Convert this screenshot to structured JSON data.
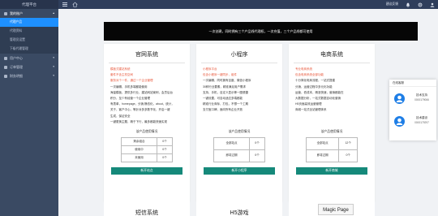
{
  "app": {
    "title": "代理平台"
  },
  "topbar": {
    "items": [
      {
        "label": "建议反馈",
        "icon": "feedback-icon"
      },
      {
        "label": "",
        "icon": "bell-icon"
      },
      {
        "label": "",
        "icon": "settings-icon"
      },
      {
        "label": "",
        "icon": "user-icon"
      }
    ]
  },
  "sidebar": {
    "groups": [
      {
        "label": "我的账户",
        "open": true,
        "subs": [
          {
            "label": "代理产品",
            "active": true
          },
          {
            "label": "代理资料"
          },
          {
            "label": "管理员设置"
          },
          {
            "label": "下级代理管理"
          }
        ]
      },
      {
        "label": "用户中心"
      },
      {
        "label": "订单管理"
      },
      {
        "label": "财务明细"
      }
    ]
  },
  "banner": {
    "text": "一次创建，同时拥有三个产品线代理权，一次充值，三个产品线都可使用"
  },
  "products": [
    {
      "title": "官网系统",
      "features": [
        {
          "text": "模板式建站系统",
          "hl": true
        },
        {
          "text": "套件不含主机空间",
          "hl": true
        },
        {
          "text": "服务对个一件，通过一个企业管理",
          "hl": true
        },
        {
          "text": "一次编辑，手机多端都能使用"
        },
        {
          "text": "海量模板，提供多行业，建站网站案例，会员后台"
        },
        {
          "text": "积分，至少有经营一个企业管理"
        },
        {
          "text": "有表单，homepage，分销,静态化，about，统计，"
        },
        {
          "text": "关于，客户中心，等针对多多数节化，开启一键"
        },
        {
          "text": "生成，保证安全"
        },
        {
          "text": "一键更换主题，精于下行，最多都能快速实现"
        }
      ],
      "price_title": "该产品使用情况",
      "price_rows": [
        [
          "剩余组合",
          "0个"
        ],
        [
          "使用中",
          "0个"
        ],
        [
          "未使用",
          "0个"
        ]
      ],
      "buy_label": "新开站点"
    },
    {
      "title": "小程序",
      "features": [
        {
          "text": "小程序平台",
          "hl": true
        },
        {
          "text": "包含小程序一键同步，组件",
          "hl": true
        },
        {
          "text": "一次编辑，同时拥有百度、微信小程序"
        },
        {
          "text": "30种行业要素，精准满足用户需求"
        },
        {
          "text": "支持，手机，自定义显示等一图便捷"
        },
        {
          "text": "一键设置，可自动适应多端都能"
        },
        {
          "text": "精准行业商标，打包，不想一个工期"
        },
        {
          "text": "支付宝口碑，面向所有企业开放"
        }
      ],
      "price_title": "该产品使用情况",
      "price_rows": [
        [
          "全部站点",
          "0个"
        ],
        [
          "即将过期",
          "0个"
        ]
      ],
      "buy_label": "新开小程序"
    },
    {
      "title": "电商系统",
      "features": [
        {
          "text": "专业电商系统",
          "hl": true
        },
        {
          "text": "包含电商系统全部功能",
          "hl": true
        },
        {
          "text": "十分简化电商流程，一站式搭建",
          "hl": false
        },
        {
          "text": "分销，运营过程中多元化功能"
        },
        {
          "text": "运营，低成本，精准快速，营销都能在"
        },
        {
          "text": "大数据分析，一站式数据自动化营销"
        },
        {
          "text": "H5页面高效运营管理"
        },
        {
          "text": "商城一站式全站管理体系"
        }
      ],
      "price_title": "该产品使用情况",
      "price_rows": [
        [
          "全部站点",
          "12个"
        ],
        [
          "即将过期",
          "0个"
        ]
      ],
      "buy_label": "新开商城"
    }
  ],
  "more_products": [
    {
      "title": "短信系统"
    },
    {
      "title": "H5游戏"
    }
  ],
  "magic_page": {
    "label": "Magic Page"
  },
  "service": {
    "title": "在线客服",
    "agents": [
      {
        "name": "技术支持",
        "phone": "0000179066"
      },
      {
        "name": "技术建设",
        "phone": "0000179297"
      }
    ]
  },
  "colors": {
    "accent": "#1e90ff",
    "button": "#15897a",
    "highlight": "#e8563a"
  }
}
